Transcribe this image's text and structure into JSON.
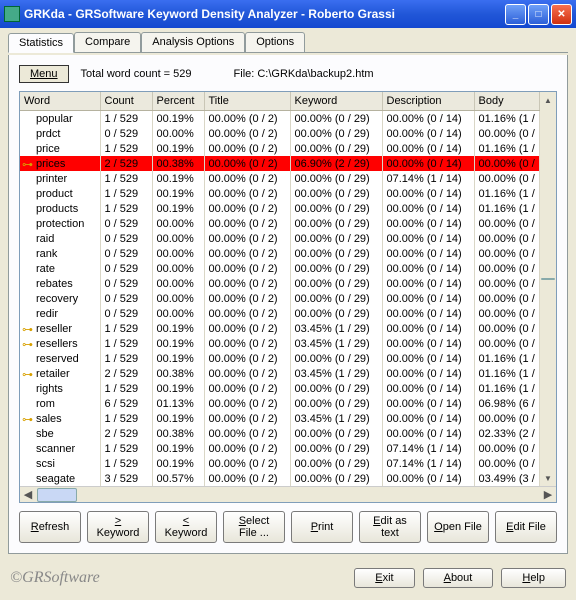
{
  "title": "GRKda - GRSoftware Keyword Density Analyzer - Roberto Grassi",
  "tabs": [
    "Statistics",
    "Compare",
    "Analysis Options",
    "Options"
  ],
  "menu_label": "Menu",
  "wordcount_label": "Total word count =  529",
  "file_label": "File: C:\\GRKda\\backup2.htm",
  "columns": [
    "Word",
    "Count",
    "Percent",
    "Title",
    "Keyword",
    "Description",
    "Body"
  ],
  "rows": [
    {
      "key": false,
      "w": "popular",
      "c": "1 / 529",
      "p": "00.19%",
      "t": "00.00% (0 / 2)",
      "k": "00.00% (0 / 29)",
      "d": "00.00% (0 / 14)",
      "b": "01.16% (1 /",
      "hl": false
    },
    {
      "key": false,
      "w": "prdct",
      "c": "0 / 529",
      "p": "00.00%",
      "t": "00.00% (0 / 2)",
      "k": "00.00% (0 / 29)",
      "d": "00.00% (0 / 14)",
      "b": "00.00% (0 /",
      "hl": false
    },
    {
      "key": false,
      "w": "price",
      "c": "1 / 529",
      "p": "00.19%",
      "t": "00.00% (0 / 2)",
      "k": "00.00% (0 / 29)",
      "d": "00.00% (0 / 14)",
      "b": "01.16% (1 /",
      "hl": false
    },
    {
      "key": true,
      "w": "prices",
      "c": "2 / 529",
      "p": "00.38%",
      "t": "00.00% (0 / 2)",
      "k": "06.90% (2 / 29)",
      "d": "00.00% (0 / 14)",
      "b": "00.00% (0 /",
      "hl": true
    },
    {
      "key": false,
      "w": "printer",
      "c": "1 / 529",
      "p": "00.19%",
      "t": "00.00% (0 / 2)",
      "k": "00.00% (0 / 29)",
      "d": "07.14% (1 / 14)",
      "b": "00.00% (0 /",
      "hl": false
    },
    {
      "key": false,
      "w": "product",
      "c": "1 / 529",
      "p": "00.19%",
      "t": "00.00% (0 / 2)",
      "k": "00.00% (0 / 29)",
      "d": "00.00% (0 / 14)",
      "b": "01.16% (1 /",
      "hl": false
    },
    {
      "key": false,
      "w": "products",
      "c": "1 / 529",
      "p": "00.19%",
      "t": "00.00% (0 / 2)",
      "k": "00.00% (0 / 29)",
      "d": "00.00% (0 / 14)",
      "b": "01.16% (1 /",
      "hl": false
    },
    {
      "key": false,
      "w": "protection",
      "c": "0 / 529",
      "p": "00.00%",
      "t": "00.00% (0 / 2)",
      "k": "00.00% (0 / 29)",
      "d": "00.00% (0 / 14)",
      "b": "00.00% (0 /",
      "hl": false
    },
    {
      "key": false,
      "w": "raid",
      "c": "0 / 529",
      "p": "00.00%",
      "t": "00.00% (0 / 2)",
      "k": "00.00% (0 / 29)",
      "d": "00.00% (0 / 14)",
      "b": "00.00% (0 /",
      "hl": false
    },
    {
      "key": false,
      "w": "rank",
      "c": "0 / 529",
      "p": "00.00%",
      "t": "00.00% (0 / 2)",
      "k": "00.00% (0 / 29)",
      "d": "00.00% (0 / 14)",
      "b": "00.00% (0 /",
      "hl": false
    },
    {
      "key": false,
      "w": "rate",
      "c": "0 / 529",
      "p": "00.00%",
      "t": "00.00% (0 / 2)",
      "k": "00.00% (0 / 29)",
      "d": "00.00% (0 / 14)",
      "b": "00.00% (0 /",
      "hl": false
    },
    {
      "key": false,
      "w": "rebates",
      "c": "0 / 529",
      "p": "00.00%",
      "t": "00.00% (0 / 2)",
      "k": "00.00% (0 / 29)",
      "d": "00.00% (0 / 14)",
      "b": "00.00% (0 /",
      "hl": false
    },
    {
      "key": false,
      "w": "recovery",
      "c": "0 / 529",
      "p": "00.00%",
      "t": "00.00% (0 / 2)",
      "k": "00.00% (0 / 29)",
      "d": "00.00% (0 / 14)",
      "b": "00.00% (0 /",
      "hl": false
    },
    {
      "key": false,
      "w": "redir",
      "c": "0 / 529",
      "p": "00.00%",
      "t": "00.00% (0 / 2)",
      "k": "00.00% (0 / 29)",
      "d": "00.00% (0 / 14)",
      "b": "00.00% (0 /",
      "hl": false
    },
    {
      "key": true,
      "w": "reseller",
      "c": "1 / 529",
      "p": "00.19%",
      "t": "00.00% (0 / 2)",
      "k": "03.45% (1 / 29)",
      "d": "00.00% (0 / 14)",
      "b": "00.00% (0 /",
      "hl": false
    },
    {
      "key": true,
      "w": "resellers",
      "c": "1 / 529",
      "p": "00.19%",
      "t": "00.00% (0 / 2)",
      "k": "03.45% (1 / 29)",
      "d": "00.00% (0 / 14)",
      "b": "00.00% (0 /",
      "hl": false
    },
    {
      "key": false,
      "w": "reserved",
      "c": "1 / 529",
      "p": "00.19%",
      "t": "00.00% (0 / 2)",
      "k": "00.00% (0 / 29)",
      "d": "00.00% (0 / 14)",
      "b": "01.16% (1 /",
      "hl": false
    },
    {
      "key": true,
      "w": "retailer",
      "c": "2 / 529",
      "p": "00.38%",
      "t": "00.00% (0 / 2)",
      "k": "03.45% (1 / 29)",
      "d": "00.00% (0 / 14)",
      "b": "01.16% (1 /",
      "hl": false
    },
    {
      "key": false,
      "w": "rights",
      "c": "1 / 529",
      "p": "00.19%",
      "t": "00.00% (0 / 2)",
      "k": "00.00% (0 / 29)",
      "d": "00.00% (0 / 14)",
      "b": "01.16% (1 /",
      "hl": false
    },
    {
      "key": false,
      "w": "rom",
      "c": "6 / 529",
      "p": "01.13%",
      "t": "00.00% (0 / 2)",
      "k": "00.00% (0 / 29)",
      "d": "00.00% (0 / 14)",
      "b": "06.98% (6 /",
      "hl": false
    },
    {
      "key": true,
      "w": "sales",
      "c": "1 / 529",
      "p": "00.19%",
      "t": "00.00% (0 / 2)",
      "k": "03.45% (1 / 29)",
      "d": "00.00% (0 / 14)",
      "b": "00.00% (0 /",
      "hl": false
    },
    {
      "key": false,
      "w": "sbe",
      "c": "2 / 529",
      "p": "00.38%",
      "t": "00.00% (0 / 2)",
      "k": "00.00% (0 / 29)",
      "d": "00.00% (0 / 14)",
      "b": "02.33% (2 /",
      "hl": false
    },
    {
      "key": false,
      "w": "scanner",
      "c": "1 / 529",
      "p": "00.19%",
      "t": "00.00% (0 / 2)",
      "k": "00.00% (0 / 29)",
      "d": "07.14% (1 / 14)",
      "b": "00.00% (0 /",
      "hl": false
    },
    {
      "key": false,
      "w": "scsi",
      "c": "1 / 529",
      "p": "00.19%",
      "t": "00.00% (0 / 2)",
      "k": "00.00% (0 / 29)",
      "d": "07.14% (1 / 14)",
      "b": "00.00% (0 /",
      "hl": false
    },
    {
      "key": false,
      "w": "seagate",
      "c": "3 / 529",
      "p": "00.57%",
      "t": "00.00% (0 / 2)",
      "k": "00.00% (0 / 29)",
      "d": "00.00% (0 / 14)",
      "b": "03.49% (3 /",
      "hl": false
    }
  ],
  "buttons_row": [
    "Refresh",
    "> Keyword",
    "< Keyword",
    "Select File ...",
    "Print",
    "Edit as text",
    "Open File",
    "Edit File"
  ],
  "brand": "©GRSoftware",
  "footer_buttons": [
    "Exit",
    "About",
    "Help"
  ]
}
